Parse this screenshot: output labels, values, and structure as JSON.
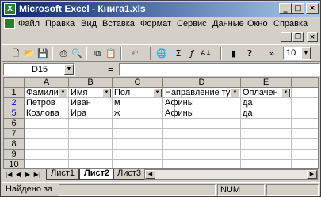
{
  "window": {
    "title": "Microsoft Excel - Книга1.xls",
    "app_icon_letter": "X",
    "controls": {
      "minimize": "_",
      "maximize": "□",
      "close": "×"
    }
  },
  "menu": [
    {
      "label": "Файл"
    },
    {
      "label": "Правка"
    },
    {
      "label": "Вид"
    },
    {
      "label": "Вставка"
    },
    {
      "label": "Формат"
    },
    {
      "label": "Сервис"
    },
    {
      "label": "Данные"
    },
    {
      "label": "Окно"
    },
    {
      "label": "Справка"
    }
  ],
  "doc_controls": {
    "minimize": "_",
    "restore": "❐",
    "close": "×"
  },
  "toolbar": {
    "icons": [
      {
        "name": "new-document-icon",
        "glyph": "🗋"
      },
      {
        "name": "open-folder-icon",
        "glyph": "📂"
      },
      {
        "name": "save-icon",
        "glyph": "💾"
      },
      {
        "name": "print-icon",
        "glyph": "⎙"
      },
      {
        "name": "print-preview-icon",
        "glyph": "🔍"
      },
      {
        "name": "copy-icon",
        "glyph": "⧉"
      },
      {
        "name": "paste-icon",
        "glyph": "📋"
      },
      {
        "name": "undo-icon",
        "glyph": "↶"
      },
      {
        "name": "hyperlink-icon",
        "glyph": "🌐"
      },
      {
        "name": "autosum-icon",
        "glyph": "Σ"
      },
      {
        "name": "function-icon",
        "glyph": "ƒ"
      },
      {
        "name": "sort-ascending-icon",
        "glyph": "A↓"
      },
      {
        "name": "chart-wizard-icon",
        "glyph": "▮"
      },
      {
        "name": "help-icon",
        "glyph": "?"
      }
    ],
    "more": "»",
    "font_size": "10"
  },
  "formula_bar": {
    "cell_ref": "D15",
    "equals": "=",
    "value": ""
  },
  "grid": {
    "columns": [
      "A",
      "B",
      "C",
      "D",
      "E"
    ],
    "row_numbers": [
      "1",
      "2",
      "5",
      "6",
      "7",
      "8",
      "9",
      "10"
    ],
    "header_row": [
      "Фамилия",
      "Имя",
      "Пол",
      "Направление ту",
      "Оплачен"
    ],
    "rows": [
      [
        "Петров",
        "Иван",
        "м",
        "Афины",
        "да"
      ],
      [
        "Козлова",
        "Ира",
        "ж",
        "Афины",
        "да"
      ]
    ],
    "blue_row_numbers": [
      "2",
      "5"
    ]
  },
  "sheets": {
    "tabs": [
      {
        "label": "Лист1",
        "active": false
      },
      {
        "label": "Лист2",
        "active": true
      },
      {
        "label": "Лист3",
        "active": false
      }
    ],
    "nav": [
      "|◀",
      "◀",
      "▶",
      "▶|"
    ]
  },
  "status": {
    "message": "Найдено за",
    "num": "NUM"
  }
}
